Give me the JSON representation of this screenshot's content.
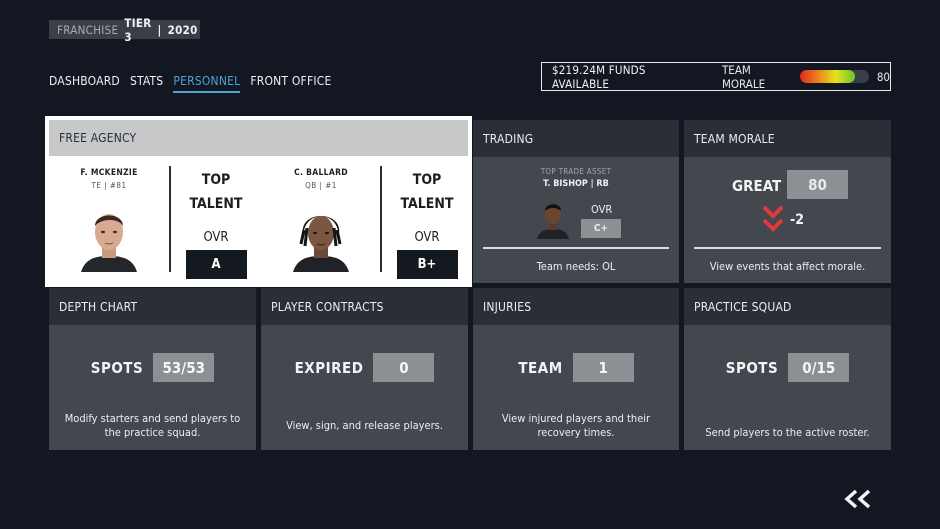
{
  "header": {
    "franchise_label": "FRANCHISE",
    "tier": "TIER 3",
    "divider": "|",
    "year": "2020"
  },
  "nav": {
    "tabs": [
      {
        "label": "DASHBOARD",
        "active": false
      },
      {
        "label": "STATS",
        "active": false
      },
      {
        "label": "PERSONNEL",
        "active": true
      },
      {
        "label": "FRONT OFFICE",
        "active": false
      }
    ]
  },
  "status": {
    "funds": "$219.24M FUNDS AVAILABLE",
    "morale_label": "TEAM MORALE",
    "morale_value": "80",
    "morale_fraction": 0.8
  },
  "free_agency": {
    "title": "FREE AGENCY",
    "players": [
      {
        "name": "F. MCKENZIE",
        "pos": "TE  |  #81",
        "talent": [
          "TOP",
          "TALENT"
        ],
        "ovr_label": "OVR",
        "grade": "A"
      },
      {
        "name": "C. BALLARD",
        "pos": "QB  |  #1",
        "talent": [
          "TOP",
          "TALENT"
        ],
        "ovr_label": "OVR",
        "grade": "B+"
      }
    ]
  },
  "trading": {
    "title": "TRADING",
    "asset_label": "TOP TRADE ASSET",
    "asset_name": "T. BISHOP | RB",
    "ovr_label": "OVR",
    "grade": "C+",
    "needs": "Team needs: OL"
  },
  "team_morale": {
    "title": "TEAM MORALE",
    "status": "GREAT",
    "value": "80",
    "delta": "-2",
    "link": "View events that affect morale."
  },
  "depth_chart": {
    "title": "DEPTH CHART",
    "label": "SPOTS",
    "value": "53/53",
    "desc": "Modify starters and send players to the practice squad."
  },
  "contracts": {
    "title": "PLAYER CONTRACTS",
    "label": "EXPIRED",
    "value": "0",
    "desc": "View, sign, and release players."
  },
  "injuries": {
    "title": "INJURIES",
    "label": "TEAM",
    "value": "1",
    "desc": "View injured players and their recovery times."
  },
  "practice_squad": {
    "title": "PRACTICE SQUAD",
    "label": "SPOTS",
    "value": "0/15",
    "desc": "Send players to the active roster."
  },
  "colors": {
    "accent": "#4fa3d6",
    "background": "#121721",
    "tile": "#43474e",
    "tile_header": "#2a2f37",
    "danger": "#e23a3a"
  },
  "icons": {
    "back": "double-chevron-left-icon",
    "morale_down": "double-chevron-down-icon"
  }
}
